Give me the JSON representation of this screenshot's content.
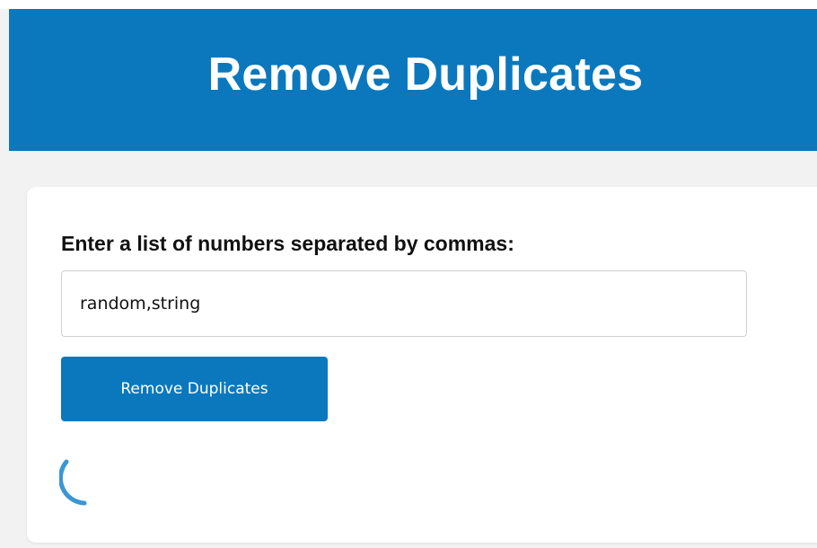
{
  "header": {
    "title": "Remove Duplicates"
  },
  "form": {
    "label": "Enter a list of numbers separated by commas:",
    "input_value": "random,string",
    "button_label": "Remove Duplicates"
  },
  "loading": {
    "icon": "loading-spinner-icon",
    "visible": true
  },
  "colors": {
    "primary": "#0b78bd",
    "spinner": "#3a96d4",
    "background": "#f2f2f2"
  }
}
